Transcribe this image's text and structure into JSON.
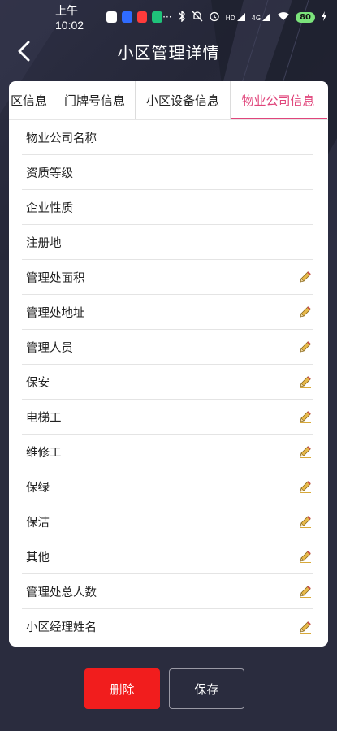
{
  "status_bar": {
    "time": "上午10:02",
    "dots": "···",
    "net1": "HD",
    "net2": "4G",
    "battery": "80",
    "app_colors": [
      "#ffffff",
      "#2f6bff",
      "#ff3b3b",
      "#1fc27a"
    ]
  },
  "header": {
    "title": "小区管理详情"
  },
  "tabs": [
    {
      "label": "区信息",
      "active": false
    },
    {
      "label": "门牌号信息",
      "active": false
    },
    {
      "label": "小区设备信息",
      "active": false
    },
    {
      "label": "物业公司信息",
      "active": true
    }
  ],
  "fields": [
    {
      "label": "物业公司名称",
      "editable": false
    },
    {
      "label": "资质等级",
      "editable": false
    },
    {
      "label": "企业性质",
      "editable": false
    },
    {
      "label": "注册地",
      "editable": false
    },
    {
      "label": "管理处面积",
      "editable": true
    },
    {
      "label": "管理处地址",
      "editable": true
    },
    {
      "label": "管理人员",
      "editable": true
    },
    {
      "label": "保安",
      "editable": true
    },
    {
      "label": "电梯工",
      "editable": true
    },
    {
      "label": "维修工",
      "editable": true
    },
    {
      "label": "保绿",
      "editable": true
    },
    {
      "label": "保洁",
      "editable": true
    },
    {
      "label": "其他",
      "editable": true
    },
    {
      "label": "管理处总人数",
      "editable": true
    },
    {
      "label": "小区经理姓名",
      "editable": true
    }
  ],
  "footer": {
    "delete_label": "删除",
    "save_label": "保存"
  },
  "colors": {
    "accent": "#e0457b",
    "danger": "#f11d1d",
    "background": "#2a2c3e",
    "edit_icon": "#e8b94a"
  },
  "icons": {
    "back": "chevron-left-icon",
    "edit": "pencil-icon"
  }
}
